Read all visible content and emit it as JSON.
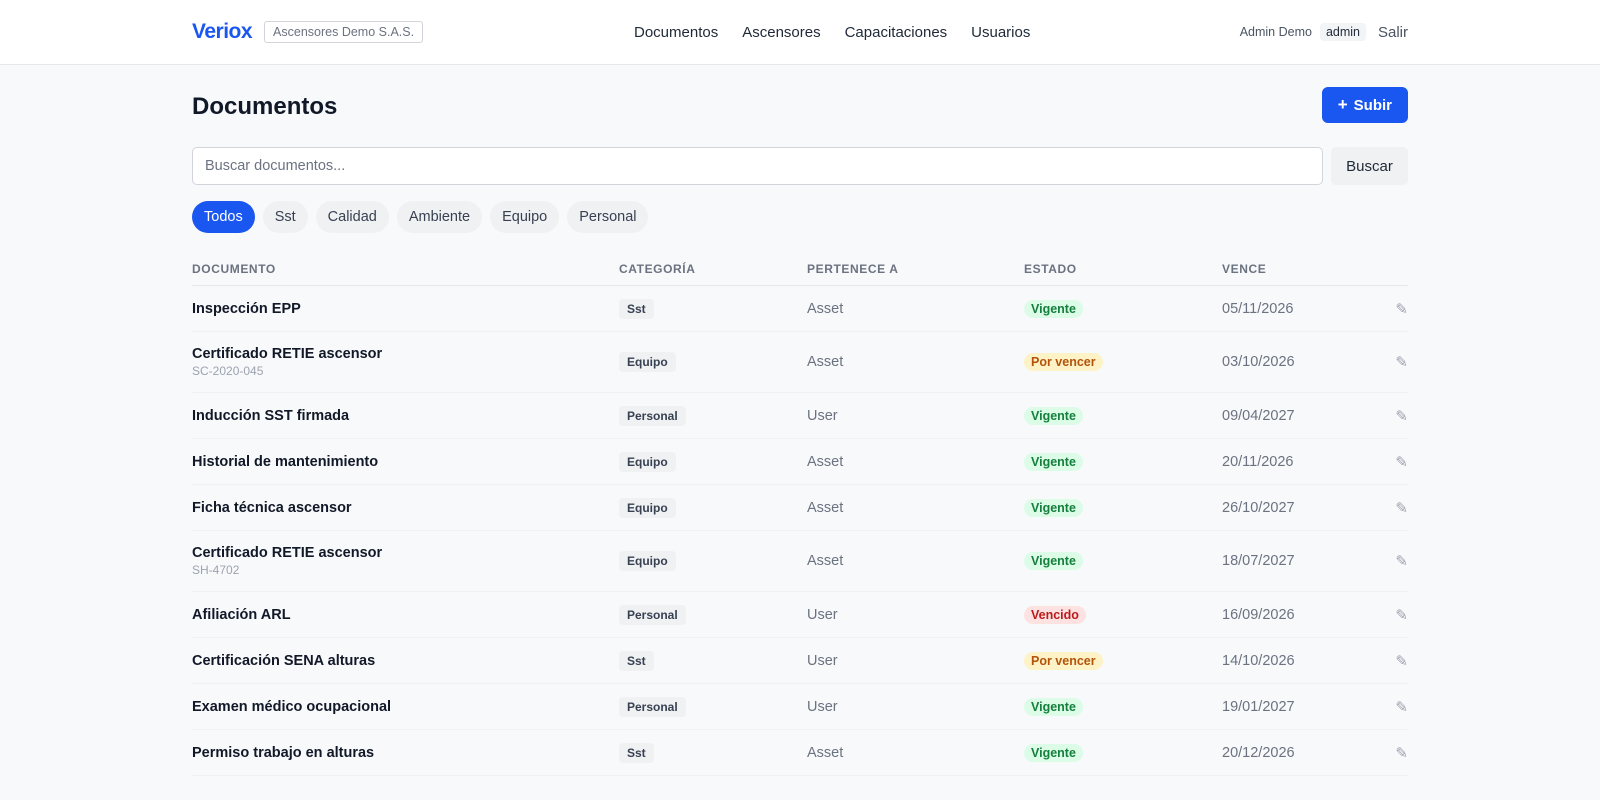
{
  "brand": {
    "logo": "Veriox",
    "org": "Ascensores Demo S.A.S.",
    "accent": "#1a56f0"
  },
  "nav": [
    "Documentos",
    "Ascensores",
    "Capacitaciones",
    "Usuarios"
  ],
  "user": {
    "name": "Admin Demo",
    "role": "admin",
    "logout": "Salir"
  },
  "page": {
    "title": "Documentos",
    "upload_plus": "+",
    "upload_label": "Subir"
  },
  "search": {
    "placeholder": "Buscar documentos...",
    "value": "",
    "button": "Buscar"
  },
  "filters": [
    {
      "label": "Todos",
      "active": true
    },
    {
      "label": "Sst",
      "active": false
    },
    {
      "label": "Calidad",
      "active": false
    },
    {
      "label": "Ambiente",
      "active": false
    },
    {
      "label": "Equipo",
      "active": false
    },
    {
      "label": "Personal",
      "active": false
    }
  ],
  "table": {
    "headers": [
      "DOCUMENTO",
      "CATEGORÍA",
      "PERTENECE A",
      "ESTADO",
      "VENCE"
    ],
    "edit_icon": "pencil-icon",
    "edit_glyph": "✎",
    "rows": [
      {
        "name": "Inspección EPP",
        "code": "",
        "category": "Sst",
        "owner": "Asset",
        "status": "Vigente",
        "status_kind": "vigente",
        "due": "05/11/2026"
      },
      {
        "name": "Certificado RETIE ascensor",
        "code": "SC-2020-045",
        "category": "Equipo",
        "owner": "Asset",
        "status": "Por vencer",
        "status_kind": "porvencer",
        "due": "03/10/2026"
      },
      {
        "name": "Inducción SST firmada",
        "code": "",
        "category": "Personal",
        "owner": "User",
        "status": "Vigente",
        "status_kind": "vigente",
        "due": "09/04/2027"
      },
      {
        "name": "Historial de mantenimiento",
        "code": "",
        "category": "Equipo",
        "owner": "Asset",
        "status": "Vigente",
        "status_kind": "vigente",
        "due": "20/11/2026"
      },
      {
        "name": "Ficha técnica ascensor",
        "code": "",
        "category": "Equipo",
        "owner": "Asset",
        "status": "Vigente",
        "status_kind": "vigente",
        "due": "26/10/2027"
      },
      {
        "name": "Certificado RETIE ascensor",
        "code": "SH-4702",
        "category": "Equipo",
        "owner": "Asset",
        "status": "Vigente",
        "status_kind": "vigente",
        "due": "18/07/2027"
      },
      {
        "name": "Afiliación ARL",
        "code": "",
        "category": "Personal",
        "owner": "User",
        "status": "Vencido",
        "status_kind": "vencido",
        "due": "16/09/2026"
      },
      {
        "name": "Certificación SENA alturas",
        "code": "",
        "category": "Sst",
        "owner": "User",
        "status": "Por vencer",
        "status_kind": "porvencer",
        "due": "14/10/2026"
      },
      {
        "name": "Examen médico ocupacional",
        "code": "",
        "category": "Personal",
        "owner": "User",
        "status": "Vigente",
        "status_kind": "vigente",
        "due": "19/01/2027"
      },
      {
        "name": "Permiso trabajo en alturas",
        "code": "",
        "category": "Sst",
        "owner": "Asset",
        "status": "Vigente",
        "status_kind": "vigente",
        "due": "20/12/2026"
      }
    ]
  }
}
